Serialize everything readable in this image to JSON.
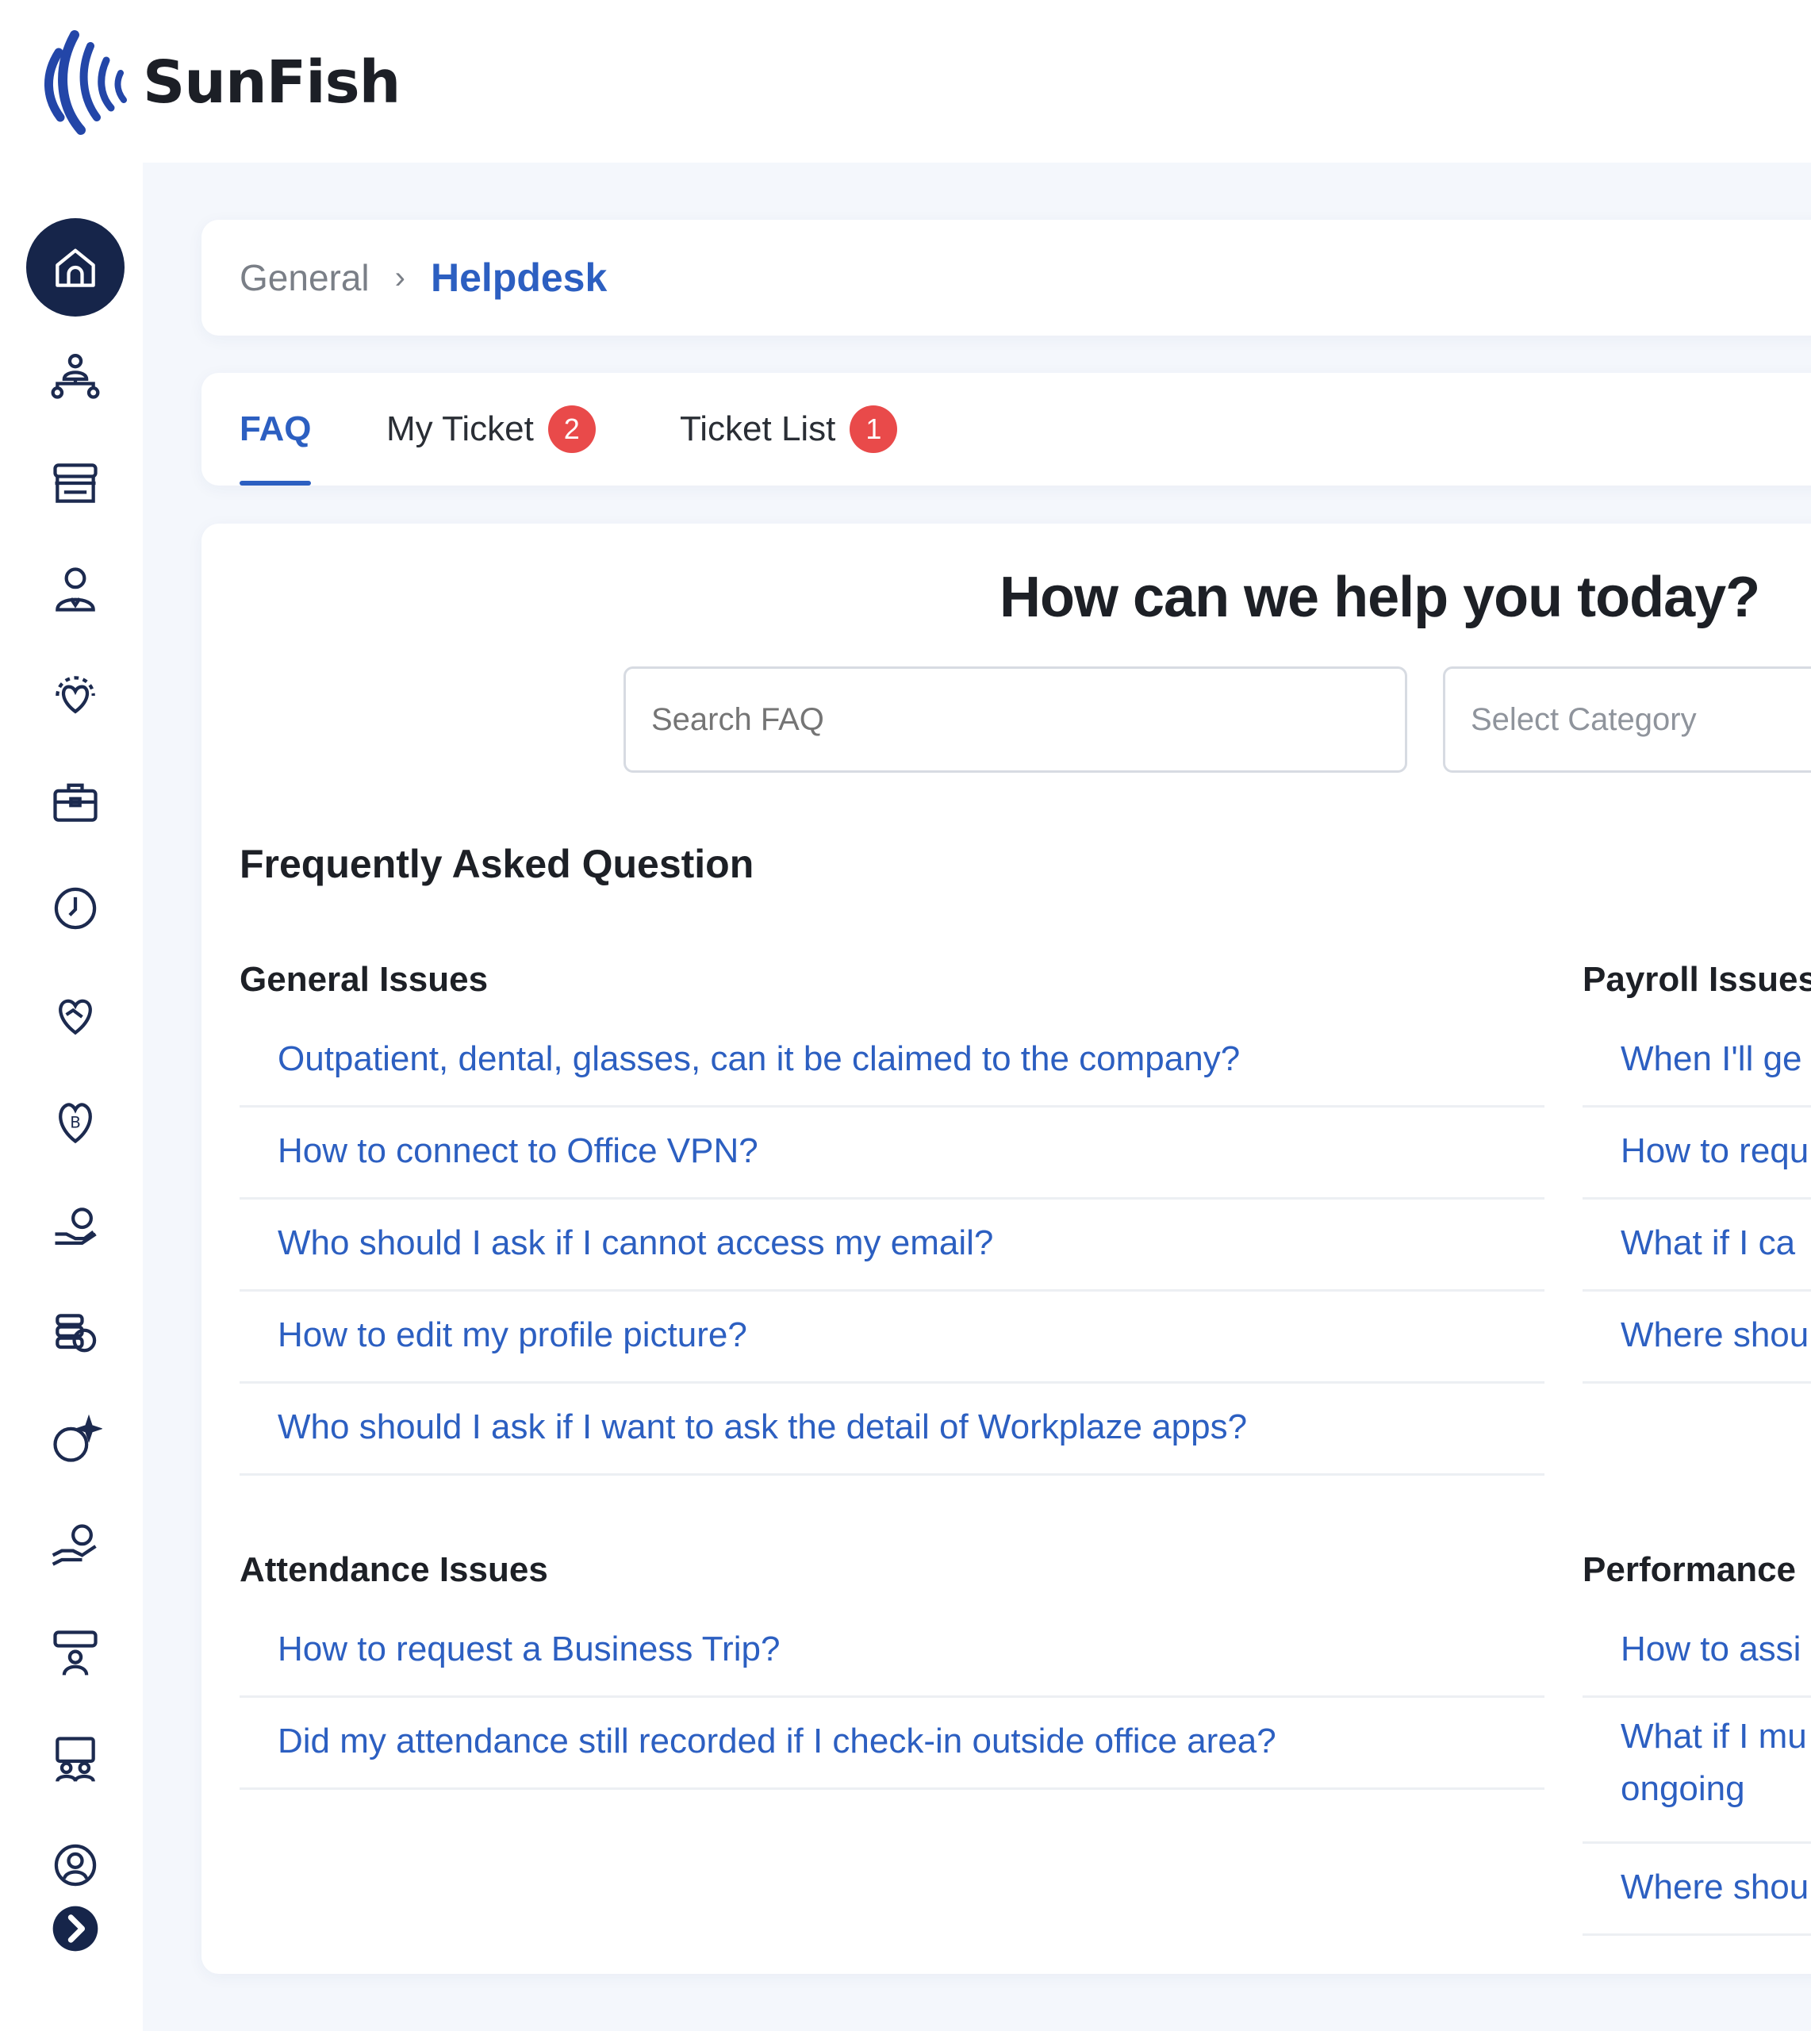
{
  "app": {
    "brand": "SunFish"
  },
  "breadcrumb": {
    "parent": "General",
    "separator": "›",
    "current": "Helpdesk"
  },
  "tabs": [
    {
      "label": "FAQ",
      "active": true
    },
    {
      "label": "My Ticket",
      "badge": "2"
    },
    {
      "label": "Ticket List",
      "badge": "1"
    }
  ],
  "main": {
    "title": "How can we help you today?",
    "search_placeholder": "Search FAQ",
    "category_placeholder": "Select Category",
    "faq_heading": "Frequently Asked Question"
  },
  "sections": {
    "general": {
      "title": "General Issues",
      "items": [
        "Outpatient, dental, glasses, can it be claimed to the company?",
        "How to connect to Office VPN?",
        "Who should I ask if I cannot access my email?",
        "How to edit my profile picture?",
        "Who should I ask if I want to ask the detail of Workplaze apps?"
      ]
    },
    "payroll": {
      "title": "Payroll Issues",
      "items": [
        "When I'll ge",
        "How to requ",
        "What if I ca",
        "Where shou"
      ]
    },
    "attendance": {
      "title": "Attendance Issues",
      "items": [
        "How to request a Business Trip?",
        "Did my attendance still recorded if I check-in outside office area?"
      ]
    },
    "performance": {
      "title": "Performance",
      "items": [
        "How to assi",
        "What if I mu ongoing",
        "Where shou"
      ]
    }
  },
  "colors": {
    "accent": "#2c5fc1",
    "nav_active": "#16254a",
    "badge": "#e94a4a"
  }
}
